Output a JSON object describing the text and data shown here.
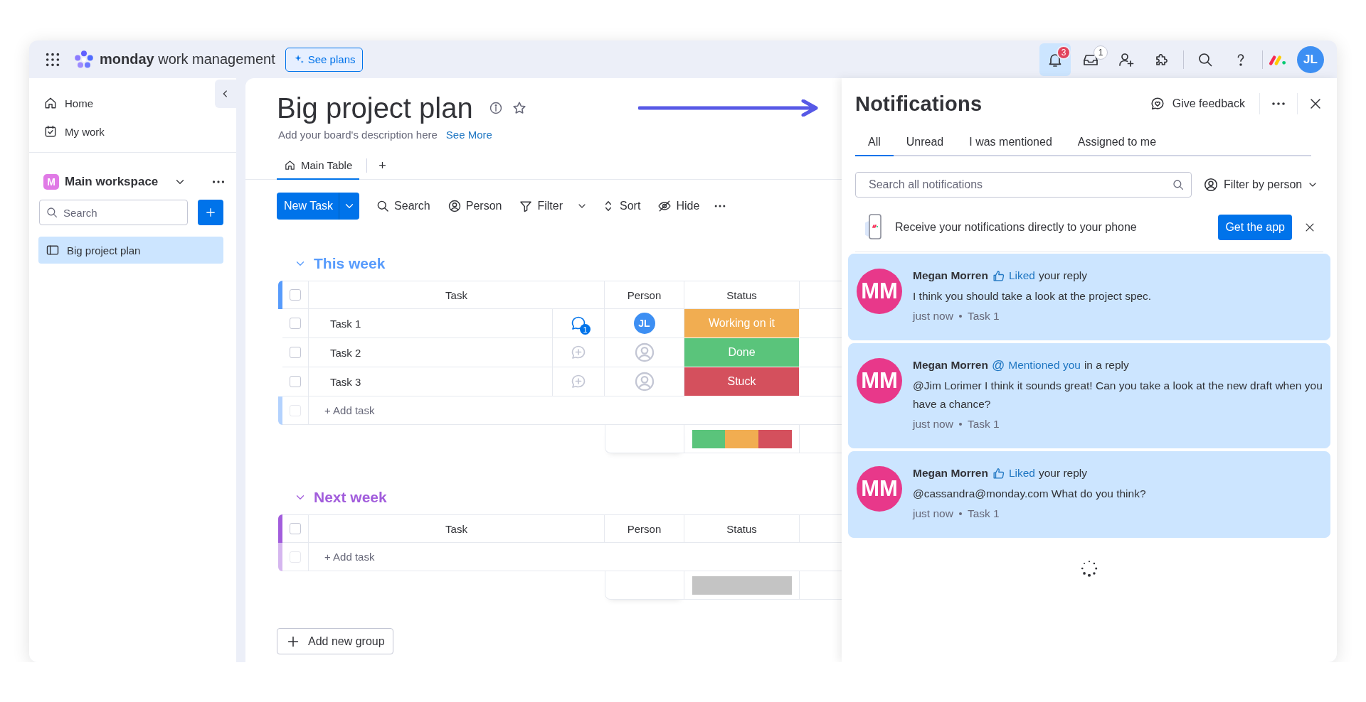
{
  "topbar": {
    "product_name": "monday",
    "product_suffix": "work management",
    "see_plans": "See plans",
    "bell": {
      "badge": "3",
      "selected": true
    },
    "inbox": {
      "badge": "1"
    },
    "avatar": "JL"
  },
  "sidebar": {
    "nav": [
      {
        "label": "Home"
      },
      {
        "label": "My work"
      }
    ],
    "workspace": {
      "initial": "M",
      "name": "Main workspace"
    },
    "search": {
      "placeholder": "Search"
    },
    "boards": [
      {
        "label": "Big project plan",
        "selected": true
      }
    ]
  },
  "board": {
    "title": "Big project plan",
    "description": "Add your board's description here",
    "see_more": "See More",
    "views": [
      {
        "label": "Main Table",
        "selected": true
      }
    ],
    "add_view": "+",
    "new_task": "New Task",
    "toolbar": [
      "Search",
      "Person",
      "Filter",
      "Sort",
      "Hide"
    ],
    "groups": [
      {
        "title": "This week",
        "color": "#579bfc",
        "header_checked": false,
        "columns": [
          "Task",
          "Person",
          "Status"
        ],
        "rows": [
          {
            "task": "Task 1",
            "checked": false,
            "updates": "1",
            "person": "JL",
            "status": "Working on it",
            "color": "#f1ad51"
          },
          {
            "task": "Task 2",
            "checked": false,
            "status": "Done",
            "color": "#5ac47b"
          },
          {
            "task": "Task 3",
            "checked": false,
            "status": "Stuck",
            "color": "#d4505d"
          }
        ],
        "add_task": "+ Add task",
        "new_row_checked": false,
        "summary": [
          {
            "color": "#5ac47b"
          },
          {
            "color": "#f1ad51"
          },
          {
            "color": "#d4505d"
          }
        ]
      },
      {
        "title": "Next week",
        "color": "#a25ddc",
        "header_checked": false,
        "columns": [
          "Task",
          "Person",
          "Status"
        ],
        "add_task": "+ Add task",
        "new_row_checked": false
      }
    ],
    "add_group": "Add new group"
  },
  "notifications": {
    "title": "Notifications",
    "give_feedback": "Give feedback",
    "tabs": [
      {
        "label": "All",
        "selected": true
      },
      {
        "label": "Unread",
        "selected": false
      },
      {
        "label": "I was mentioned",
        "selected": false
      },
      {
        "label": "Assigned to me",
        "selected": false
      }
    ],
    "search": {
      "placeholder": "Search all notifications"
    },
    "filter_by_person": "Filter by person",
    "promo": {
      "text": "Receive your notifications directly to your phone",
      "button": "Get the app"
    },
    "items": [
      {
        "avatar": "MM",
        "author": "Megan Morren",
        "kind": "like",
        "action": "Liked",
        "context": "your reply",
        "body": "I think you should take a look at the project spec.",
        "time": "just now",
        "task": "Task 1",
        "unread": true
      },
      {
        "avatar": "MM",
        "author": "Megan Morren",
        "kind": "mention",
        "symbol": "@",
        "action": "Mentioned you",
        "context": "in a reply",
        "body": "@Jim Lorimer I think it sounds great! Can you take a look at the new draft when you have a chance?",
        "time": "just now",
        "task": "Task 1",
        "unread": true
      },
      {
        "avatar": "MM",
        "author": "Megan Morren",
        "kind": "like",
        "action": "Liked",
        "context": "your reply",
        "body": "@cassandra@monday.com What do you think?",
        "time": "just now",
        "task": "Task 1",
        "unread": true
      }
    ]
  }
}
